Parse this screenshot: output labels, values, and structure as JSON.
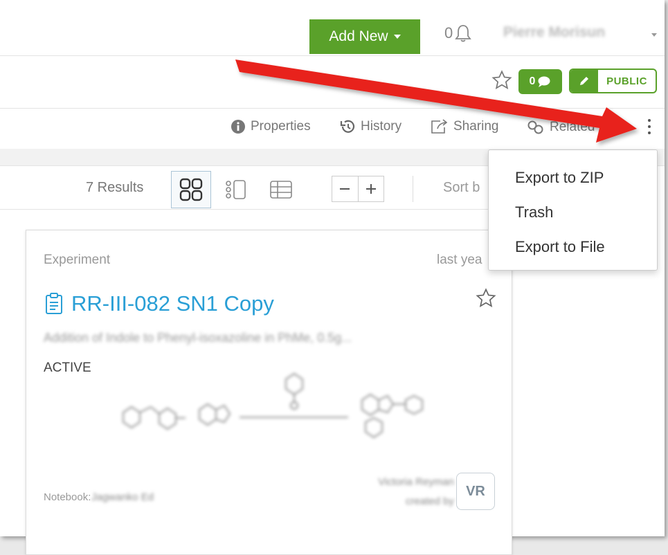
{
  "header": {
    "add_new_label": "Add New",
    "notification_count": "0",
    "user_name": "Pierre Morisun"
  },
  "badges": {
    "comment_count": "0",
    "visibility": "PUBLIC"
  },
  "tabs": [
    {
      "label": "Properties",
      "icon": "info-icon"
    },
    {
      "label": "History",
      "icon": "history-icon"
    },
    {
      "label": "Sharing",
      "icon": "share-icon"
    },
    {
      "label": "Related",
      "icon": "link-icon"
    }
  ],
  "toolbar": {
    "results": "7 Results",
    "sort_label": "Sort b"
  },
  "menu": {
    "items": [
      "Export to ZIP",
      "Trash",
      "Export to File"
    ]
  },
  "card": {
    "type": "Experiment",
    "date": "last yea",
    "title": "RR-III-082 SN1 Copy",
    "subtitle": "Addition of Indole to Phenyl-isoxazoline in PhMe, 0.5g...",
    "status": "ACTIVE",
    "notebook_label": "Notebook:",
    "notebook_value": "Jagwanko Ed",
    "owner_line1": "Victoria Reyman",
    "owner_line2": "created by",
    "owner_initials": "VR"
  },
  "colors": {
    "accent_green": "#5aa12a",
    "link_blue": "#2a9fd6",
    "annotation_arrow": "#e8211c"
  }
}
